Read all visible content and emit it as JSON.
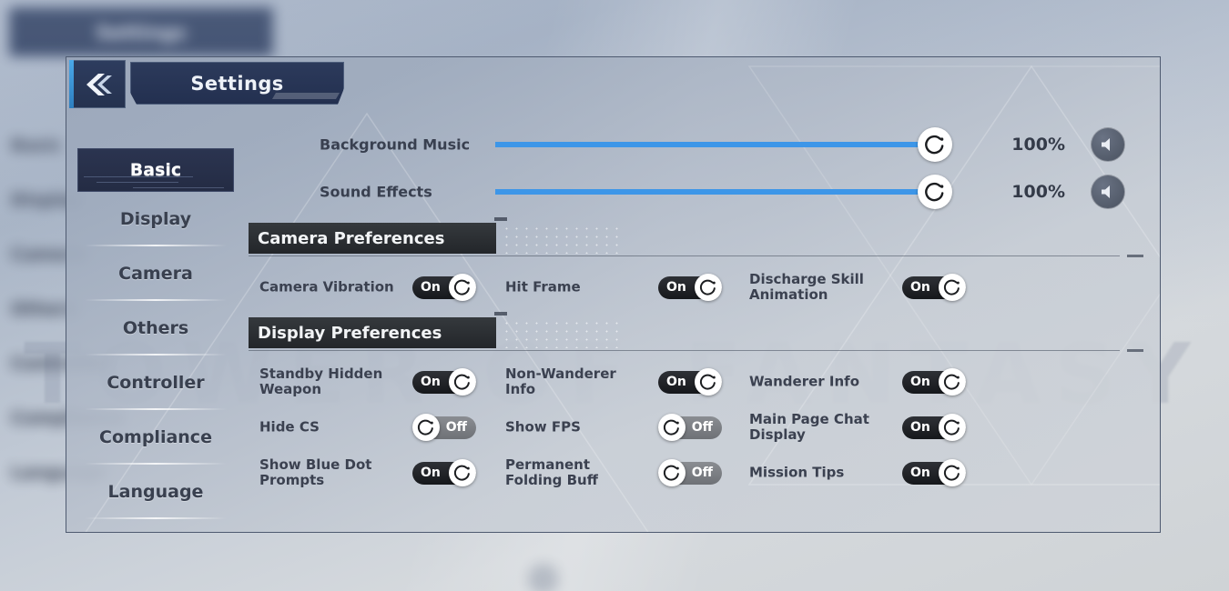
{
  "background": {
    "topbar_title": "Settings",
    "menu": [
      "Basic",
      "Display",
      "Camera",
      "Others",
      "Controller",
      "Compliance",
      "Language"
    ],
    "watermark": "TOWER OF FANTASY"
  },
  "dialog": {
    "back_icon": "double-chevron-left-icon",
    "title": "Settings"
  },
  "sidebar": {
    "items": [
      {
        "label": "Basic",
        "active": true
      },
      {
        "label": "Display",
        "active": false
      },
      {
        "label": "Camera",
        "active": false
      },
      {
        "label": "Others",
        "active": false
      },
      {
        "label": "Controller",
        "active": false
      },
      {
        "label": "Compliance",
        "active": false
      },
      {
        "label": "Language",
        "active": false
      }
    ]
  },
  "sliders": [
    {
      "label": "Background Music",
      "value": 100,
      "value_text": "100%",
      "icon": "speaker-icon"
    },
    {
      "label": "Sound Effects",
      "value": 100,
      "value_text": "100%",
      "icon": "speaker-icon"
    }
  ],
  "sections": [
    {
      "title": "Camera Preferences",
      "rows": [
        [
          {
            "label": "Camera Vibration",
            "state": "On"
          },
          {
            "label": "Hit Frame",
            "state": "On"
          },
          {
            "label": "Discharge Skill Animation",
            "state": "On"
          }
        ]
      ]
    },
    {
      "title": "Display Preferences",
      "rows": [
        [
          {
            "label": "Standby Hidden Weapon",
            "state": "On"
          },
          {
            "label": "Non-Wanderer Info",
            "state": "On"
          },
          {
            "label": "Wanderer Info",
            "state": "On"
          }
        ],
        [
          {
            "label": "Hide CS",
            "state": "Off"
          },
          {
            "label": "Show FPS",
            "state": "Off"
          },
          {
            "label": "Main Page Chat Display",
            "state": "On"
          }
        ],
        [
          {
            "label": "Show Blue Dot Prompts",
            "state": "On"
          },
          {
            "label": "Permanent Folding Buff",
            "state": "Off"
          },
          {
            "label": "Mission Tips",
            "state": "On"
          }
        ]
      ]
    }
  ],
  "colors": {
    "slider_fill": "#3d96e8",
    "accent_cyan": "#4aa8e8",
    "panel_dark": "#2c3a5b",
    "toggle_on": "#16181b",
    "toggle_off": "#7a7d82"
  }
}
